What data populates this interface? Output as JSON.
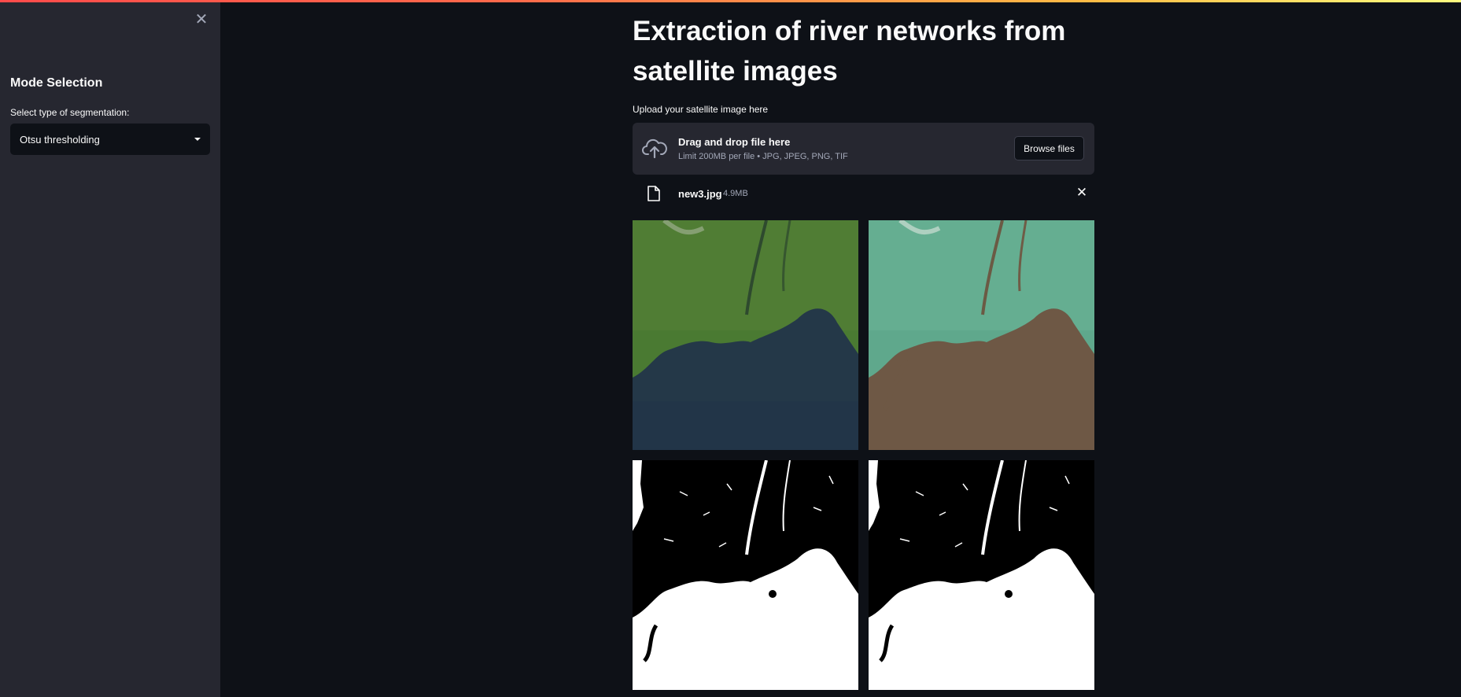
{
  "sidebar": {
    "close_glyph": "✕",
    "heading": "Mode Selection",
    "select_label": "Select type of segmentation:",
    "select_value": "Otsu thresholding"
  },
  "main": {
    "title": "Extraction of river networks from satellite images",
    "upload_label": "Upload your satellite image here",
    "dropzone": {
      "title": "Drag and drop file here",
      "subtitle": "Limit 200MB per file • JPG, JPEG, PNG, TIF",
      "browse_label": "Browse files"
    },
    "file": {
      "name": "new3.jpg",
      "size": "4.9MB",
      "remove_glyph": "✕"
    }
  },
  "colors": {
    "background": "#0e1117",
    "sidebar": "#262730",
    "accent": "#ff4b4b"
  }
}
